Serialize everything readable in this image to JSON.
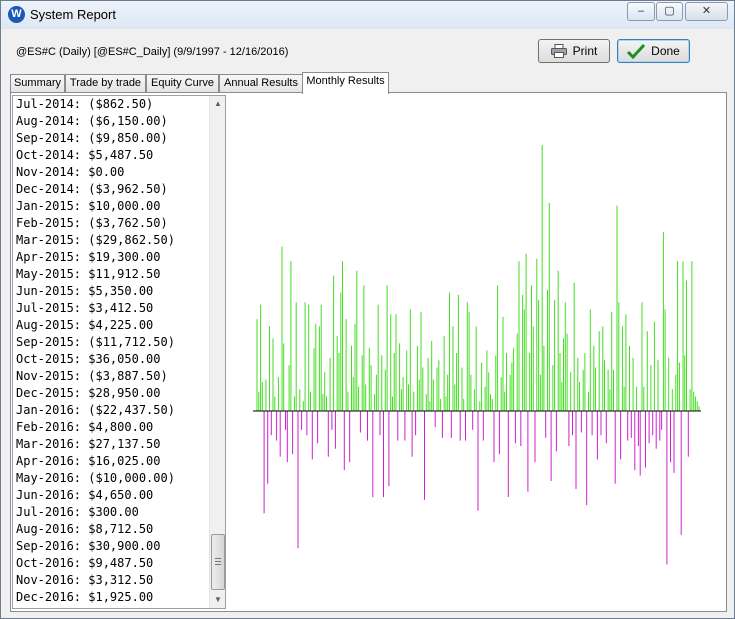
{
  "window": {
    "title": "System Report",
    "controls": [
      "minimize",
      "maximize",
      "close"
    ]
  },
  "header": {
    "symbol_range": "@ES#C (Daily) [@ES#C_Daily]  (9/9/1997 - 12/16/2016)"
  },
  "buttons": {
    "print_label": "Print",
    "done_label": "Done"
  },
  "tabs": [
    {
      "label": "Summary",
      "active": false
    },
    {
      "label": "Trade by trade",
      "active": false
    },
    {
      "label": "Equity Curve",
      "active": false
    },
    {
      "label": "Annual Results",
      "active": false
    },
    {
      "label": "Monthly Results",
      "active": true
    }
  ],
  "monthly_list": [
    "Jul-2014: ($862.50)",
    "Aug-2014: ($6,150.00)",
    "Sep-2014: ($9,850.00)",
    "Oct-2014: $5,487.50",
    "Nov-2014: $0.00",
    "Dec-2014: ($3,962.50)",
    "Jan-2015: $10,000.00",
    "Feb-2015: ($3,762.50)",
    "Mar-2015: ($29,862.50)",
    "Apr-2015: $19,300.00",
    "May-2015: $11,912.50",
    "Jun-2015: $5,350.00",
    "Jul-2015: $3,412.50",
    "Aug-2015: $4,225.00",
    "Sep-2015: ($11,712.50)",
    "Oct-2015: $36,050.00",
    "Nov-2015: ($3,887.50)",
    "Dec-2015: $28,950.00",
    "Jan-2016: ($22,437.50)",
    "Feb-2016: $4,800.00",
    "Mar-2016: $27,137.50",
    "Apr-2016: $16,025.00",
    "May-2016: ($10,000.00)",
    "Jun-2016: $4,650.00",
    "Jul-2016: $300.00",
    "Aug-2016: $8,712.50",
    "Sep-2016: $30,900.00",
    "Oct-2016: $9,487.50",
    "Nov-2016: $3,312.50",
    "Dec-2016: $1,925.00"
  ],
  "chart_data": {
    "type": "bar",
    "colors": {
      "positive": "#44dd22",
      "negative": "#cc22cc",
      "zero_line": "#000000"
    },
    "ylim": [
      -55000,
      110000
    ],
    "values": [
      38000,
      8000,
      44000,
      12000,
      -38000,
      13000,
      -27000,
      35000,
      -9000,
      30000,
      6000,
      -11000,
      14000,
      -17000,
      68000,
      28000,
      -7000,
      -19000,
      19000,
      62000,
      -16000,
      6000,
      45000,
      -51000,
      9000,
      -7000,
      4000,
      45000,
      -9000,
      44000,
      8000,
      -18000,
      26000,
      36000,
      -12000,
      35000,
      44000,
      7000,
      16000,
      6000,
      -17000,
      22000,
      -7000,
      56000,
      -14000,
      31000,
      24000,
      49000,
      62000,
      -22000,
      38000,
      8000,
      -19000,
      27000,
      14000,
      36000,
      58000,
      10000,
      -8000,
      23000,
      52000,
      11000,
      -11000,
      26000,
      19000,
      -32000,
      7000,
      15000,
      44000,
      -9000,
      23000,
      -32000,
      17000,
      52000,
      -28000,
      40000,
      6000,
      24000,
      40000,
      -11000,
      28000,
      9000,
      14000,
      -11000,
      25000,
      11000,
      42000,
      -17000,
      8000,
      -9000,
      27000,
      13000,
      41000,
      18000,
      -33000,
      7000,
      22000,
      4000,
      29000,
      13000,
      -6000,
      18000,
      21000,
      5000,
      -10000,
      31000,
      6000,
      15000,
      49000,
      -10000,
      35000,
      11000,
      24000,
      48000,
      -11000,
      18000,
      5000,
      -11000,
      45000,
      41000,
      15000,
      -7000,
      9000,
      35000,
      -37000,
      4000,
      20000,
      -11000,
      10000,
      25000,
      16000,
      7000,
      5000,
      -19000,
      23000,
      52000,
      -16000,
      14000,
      39000,
      8000,
      24000,
      -32000,
      15000,
      20000,
      26000,
      -12000,
      32000,
      62000,
      -13000,
      48000,
      42000,
      65000,
      -30000,
      24000,
      52000,
      35000,
      -19000,
      63000,
      46000,
      15000,
      110000,
      27000,
      -10000,
      50000,
      86000,
      -26000,
      19000,
      46000,
      -15000,
      58000,
      24000,
      12000,
      30000,
      45000,
      32000,
      -13000,
      16000,
      -9000,
      53000,
      -29000,
      22000,
      12000,
      -8000,
      17000,
      24000,
      -35000,
      8000,
      42000,
      -9000,
      27000,
      18000,
      -18000,
      33000,
      -9000,
      35000,
      21000,
      -12000,
      17000,
      9000,
      41000,
      17000,
      -27000,
      85000,
      45000,
      -18000,
      35000,
      10000,
      40000,
      -11000,
      27000,
      -10000,
      22000,
      -22000,
      10000,
      -13000,
      -24000,
      45000,
      10000,
      -21000,
      33000,
      -12000,
      19000,
      -9000,
      37000,
      -14000,
      21000,
      -11000,
      -7000,
      74000,
      42000,
      -57000,
      22000,
      -19000,
      9000,
      -23000,
      15000,
      62000,
      20000,
      -46000,
      62000,
      23000,
      54000,
      -17000,
      9000,
      62000,
      8000,
      6000,
      4000,
      2000
    ]
  }
}
